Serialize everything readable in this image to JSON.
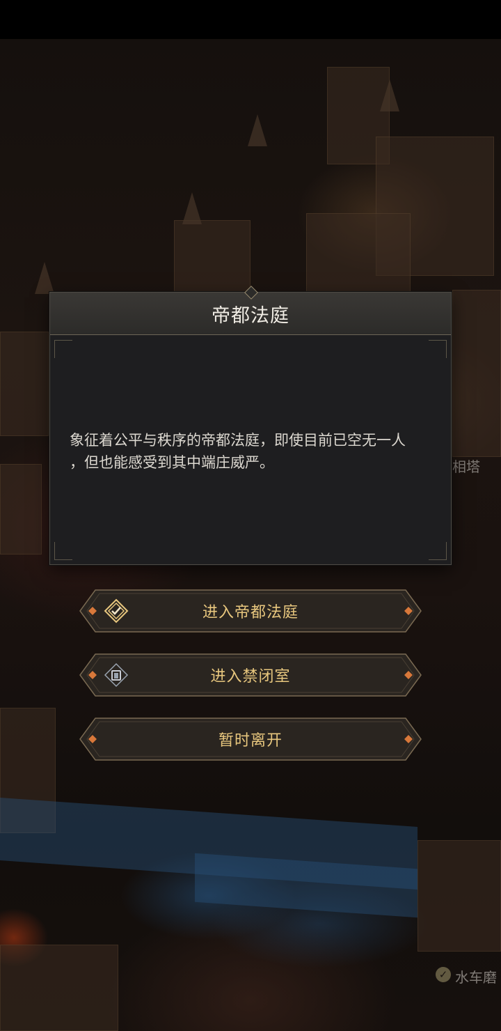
{
  "dialog": {
    "title": "帝都法庭",
    "description_line1": "象征着公平与秩序的帝都法庭，即使目前已空无一人",
    "description_line2": "，但也能感受到其中端庄威严。"
  },
  "options": [
    {
      "label": "进入帝都法庭",
      "icon": "checkmark-diamond-icon"
    },
    {
      "label": "进入禁闭室",
      "icon": "lock-diamond-icon"
    },
    {
      "label": "暂时离开",
      "icon": ""
    }
  ],
  "map_labels": {
    "tower": "相塔",
    "mill": "水车磨"
  },
  "colors": {
    "button_text": "#e8c77e",
    "button_accent": "#d8783a",
    "dialog_bg": "#1e1e20",
    "title_text": "#f0ece4"
  }
}
